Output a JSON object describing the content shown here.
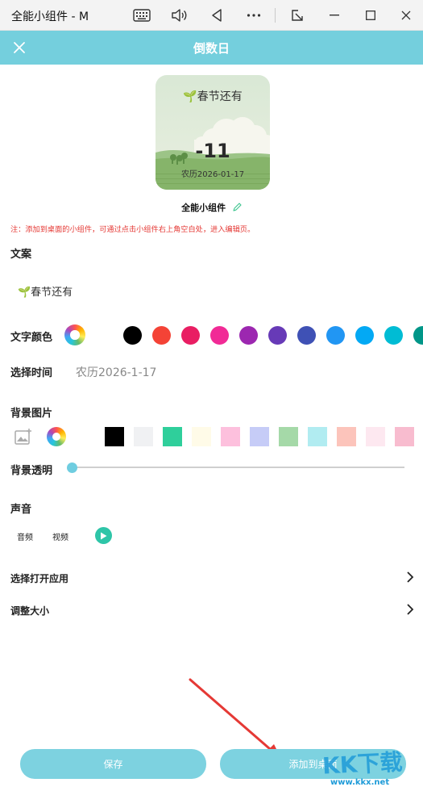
{
  "window": {
    "title": "全能小组件 - M",
    "buttons": [
      "keyboard-icon",
      "volume-icon",
      "back-icon",
      "more-icon",
      "cast-icon",
      "minimize-icon",
      "maximize-icon",
      "close-icon"
    ]
  },
  "header": {
    "title": "倒数日",
    "close_icon": "close-icon",
    "color": "#74cfdd"
  },
  "preview": {
    "text": "🌱春节还有",
    "number": "-11",
    "date": "农历2026-01-17",
    "widget_name": "全能小组件"
  },
  "note": "注：添加到桌面的小组件，可通过点击小组件右上角空白处，进入编辑页。",
  "wenan": {
    "label": "文案",
    "value": "🌱春节还有"
  },
  "text_color": {
    "label": "文字颜色",
    "colors": [
      "#000000",
      "#f44336",
      "#e91e63",
      "#f12a96",
      "#9c27b0",
      "#673ab7",
      "#3f51b5",
      "#2196f3",
      "#03a9f4",
      "#00bcd4",
      "#009688"
    ]
  },
  "time": {
    "label": "选择时间",
    "value": "农历2026-1-17"
  },
  "background": {
    "label": "背景图片",
    "colors": [
      "#ffffff",
      "#000000",
      "#f0f1f3",
      "#2fcf9b",
      "#fffbe8",
      "#fdc0dd",
      "#c6ccf7",
      "#a5d9a8",
      "#b1ecf1",
      "#fcc4bb",
      "#fde8f0",
      "#f8bccf"
    ]
  },
  "opacity": {
    "label": "背景透明",
    "value": 0
  },
  "sound": {
    "label": "声音",
    "options": [
      "音频",
      "视频"
    ]
  },
  "rows": {
    "open_app": "选择打开应用",
    "resize": "调整大小"
  },
  "buttons": {
    "save": "保存",
    "add": "添加到桌面"
  },
  "watermark": {
    "text": "KK下载",
    "url": "www.kkx.net"
  }
}
